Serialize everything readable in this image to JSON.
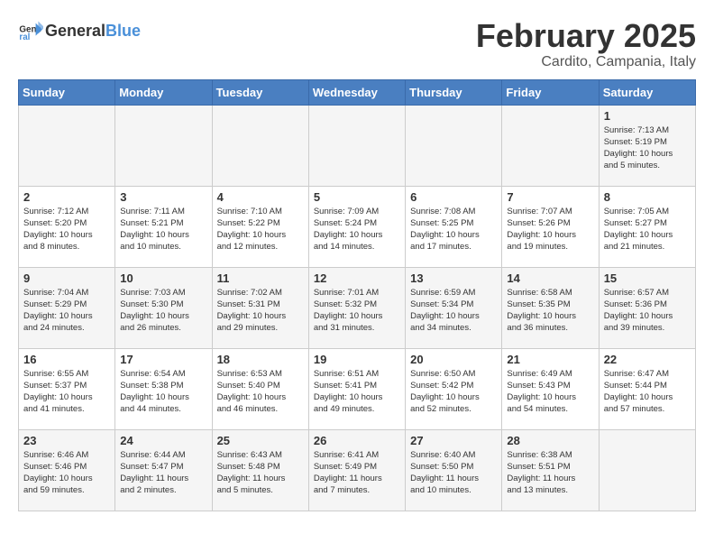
{
  "header": {
    "logo_general": "General",
    "logo_blue": "Blue",
    "title": "February 2025",
    "subtitle": "Cardito, Campania, Italy"
  },
  "weekdays": [
    "Sunday",
    "Monday",
    "Tuesday",
    "Wednesday",
    "Thursday",
    "Friday",
    "Saturday"
  ],
  "weeks": [
    [
      {
        "day": "",
        "info": ""
      },
      {
        "day": "",
        "info": ""
      },
      {
        "day": "",
        "info": ""
      },
      {
        "day": "",
        "info": ""
      },
      {
        "day": "",
        "info": ""
      },
      {
        "day": "",
        "info": ""
      },
      {
        "day": "1",
        "info": "Sunrise: 7:13 AM\nSunset: 5:19 PM\nDaylight: 10 hours\nand 5 minutes."
      }
    ],
    [
      {
        "day": "2",
        "info": "Sunrise: 7:12 AM\nSunset: 5:20 PM\nDaylight: 10 hours\nand 8 minutes."
      },
      {
        "day": "3",
        "info": "Sunrise: 7:11 AM\nSunset: 5:21 PM\nDaylight: 10 hours\nand 10 minutes."
      },
      {
        "day": "4",
        "info": "Sunrise: 7:10 AM\nSunset: 5:22 PM\nDaylight: 10 hours\nand 12 minutes."
      },
      {
        "day": "5",
        "info": "Sunrise: 7:09 AM\nSunset: 5:24 PM\nDaylight: 10 hours\nand 14 minutes."
      },
      {
        "day": "6",
        "info": "Sunrise: 7:08 AM\nSunset: 5:25 PM\nDaylight: 10 hours\nand 17 minutes."
      },
      {
        "day": "7",
        "info": "Sunrise: 7:07 AM\nSunset: 5:26 PM\nDaylight: 10 hours\nand 19 minutes."
      },
      {
        "day": "8",
        "info": "Sunrise: 7:05 AM\nSunset: 5:27 PM\nDaylight: 10 hours\nand 21 minutes."
      }
    ],
    [
      {
        "day": "9",
        "info": "Sunrise: 7:04 AM\nSunset: 5:29 PM\nDaylight: 10 hours\nand 24 minutes."
      },
      {
        "day": "10",
        "info": "Sunrise: 7:03 AM\nSunset: 5:30 PM\nDaylight: 10 hours\nand 26 minutes."
      },
      {
        "day": "11",
        "info": "Sunrise: 7:02 AM\nSunset: 5:31 PM\nDaylight: 10 hours\nand 29 minutes."
      },
      {
        "day": "12",
        "info": "Sunrise: 7:01 AM\nSunset: 5:32 PM\nDaylight: 10 hours\nand 31 minutes."
      },
      {
        "day": "13",
        "info": "Sunrise: 6:59 AM\nSunset: 5:34 PM\nDaylight: 10 hours\nand 34 minutes."
      },
      {
        "day": "14",
        "info": "Sunrise: 6:58 AM\nSunset: 5:35 PM\nDaylight: 10 hours\nand 36 minutes."
      },
      {
        "day": "15",
        "info": "Sunrise: 6:57 AM\nSunset: 5:36 PM\nDaylight: 10 hours\nand 39 minutes."
      }
    ],
    [
      {
        "day": "16",
        "info": "Sunrise: 6:55 AM\nSunset: 5:37 PM\nDaylight: 10 hours\nand 41 minutes."
      },
      {
        "day": "17",
        "info": "Sunrise: 6:54 AM\nSunset: 5:38 PM\nDaylight: 10 hours\nand 44 minutes."
      },
      {
        "day": "18",
        "info": "Sunrise: 6:53 AM\nSunset: 5:40 PM\nDaylight: 10 hours\nand 46 minutes."
      },
      {
        "day": "19",
        "info": "Sunrise: 6:51 AM\nSunset: 5:41 PM\nDaylight: 10 hours\nand 49 minutes."
      },
      {
        "day": "20",
        "info": "Sunrise: 6:50 AM\nSunset: 5:42 PM\nDaylight: 10 hours\nand 52 minutes."
      },
      {
        "day": "21",
        "info": "Sunrise: 6:49 AM\nSunset: 5:43 PM\nDaylight: 10 hours\nand 54 minutes."
      },
      {
        "day": "22",
        "info": "Sunrise: 6:47 AM\nSunset: 5:44 PM\nDaylight: 10 hours\nand 57 minutes."
      }
    ],
    [
      {
        "day": "23",
        "info": "Sunrise: 6:46 AM\nSunset: 5:46 PM\nDaylight: 10 hours\nand 59 minutes."
      },
      {
        "day": "24",
        "info": "Sunrise: 6:44 AM\nSunset: 5:47 PM\nDaylight: 11 hours\nand 2 minutes."
      },
      {
        "day": "25",
        "info": "Sunrise: 6:43 AM\nSunset: 5:48 PM\nDaylight: 11 hours\nand 5 minutes."
      },
      {
        "day": "26",
        "info": "Sunrise: 6:41 AM\nSunset: 5:49 PM\nDaylight: 11 hours\nand 7 minutes."
      },
      {
        "day": "27",
        "info": "Sunrise: 6:40 AM\nSunset: 5:50 PM\nDaylight: 11 hours\nand 10 minutes."
      },
      {
        "day": "28",
        "info": "Sunrise: 6:38 AM\nSunset: 5:51 PM\nDaylight: 11 hours\nand 13 minutes."
      },
      {
        "day": "",
        "info": ""
      }
    ]
  ]
}
